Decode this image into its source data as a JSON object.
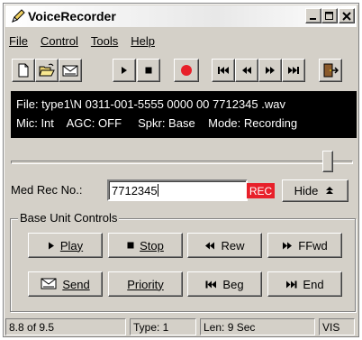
{
  "window": {
    "title": "VoiceRecorder"
  },
  "menu": {
    "file": "File",
    "control": "Control",
    "tools": "Tools",
    "help": "Help"
  },
  "toolbar": {
    "icons": [
      "new-icon",
      "open-icon",
      "mail-icon",
      "play-icon",
      "stop-icon",
      "record-icon",
      "rewind-begin-icon",
      "rewind-icon",
      "fast-forward-icon",
      "forward-end-icon",
      "exit-door-icon"
    ]
  },
  "display": {
    "file_line": "File: type1\\N 0311-001-5555 0000 00 7712345 .wav",
    "mic": "Mic: Int",
    "agc": "AGC: OFF",
    "spkr": "Spkr: Base",
    "mode": "Mode: Recording"
  },
  "position": {
    "slider_fraction": 0.94
  },
  "med_rec": {
    "label": "Med Rec No.:",
    "value": "7712345"
  },
  "rec_badge": "REC",
  "hide_button": "Hide",
  "base_unit": {
    "legend": "Base Unit Controls",
    "play": "Play",
    "stop": "Stop",
    "rew": "Rew",
    "ffwd": "FFwd",
    "send": "Send",
    "priority": "Priority",
    "beg": "Beg",
    "end": "End"
  },
  "status": {
    "progress": "8.8 of 9.5",
    "type": "Type: 1",
    "len": "Len: 9 Sec",
    "vis": "VIS"
  },
  "colors": {
    "record_red": "#e8202a",
    "display_bg": "#000000",
    "face": "#d4d0c8"
  }
}
